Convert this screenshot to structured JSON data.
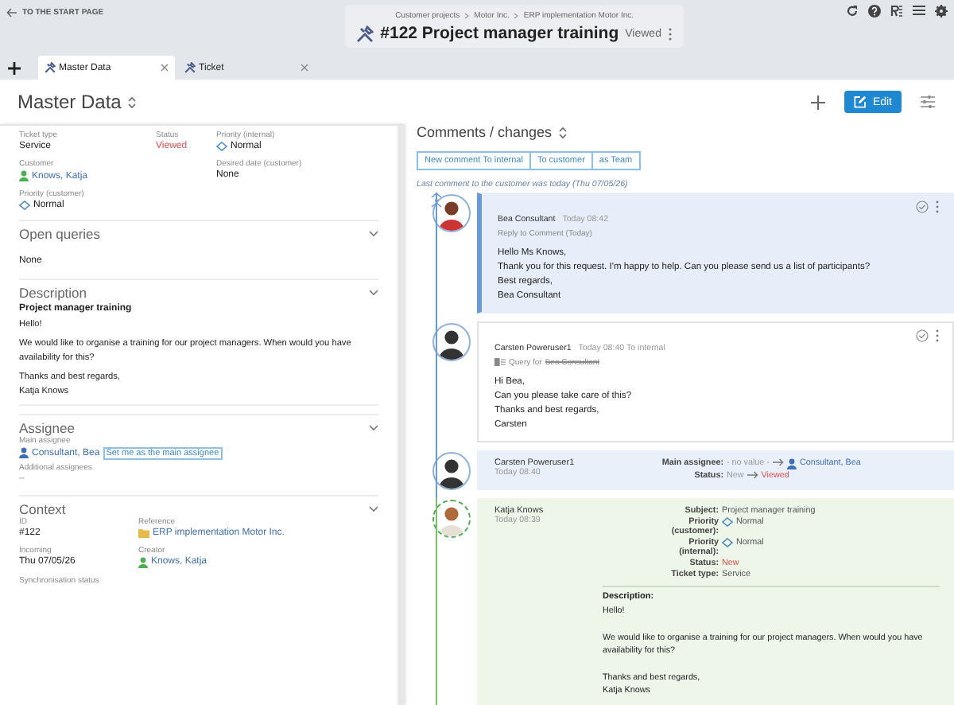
{
  "start_link": "TO THE START PAGE",
  "breadcrumbs": [
    "Customer projects",
    "Motor Inc.",
    "ERP implementation Motor Inc."
  ],
  "title": "#122 Project manager training",
  "title_status": "Viewed",
  "tabs": [
    {
      "label": "Master Data",
      "selected": true
    },
    {
      "label": "Ticket",
      "selected": false
    }
  ],
  "master_data": {
    "title": "Master Data",
    "field_rows": [
      [
        {
          "label": "Ticket type",
          "value": "Service",
          "kind": "text"
        },
        {
          "label": "Status",
          "value": "Viewed",
          "kind": "status"
        },
        {
          "label": "Priority (internal)",
          "value": "Normal",
          "kind": "priority"
        }
      ],
      [
        {
          "label": "Customer",
          "value": "Knows, Katja",
          "kind": "person",
          "color": "#4caf50"
        },
        {
          "label": "Desired date (customer)",
          "value": "None",
          "kind": "text"
        }
      ],
      [
        {
          "label": "Priority (customer)",
          "value": "Normal",
          "kind": "priority"
        }
      ]
    ]
  },
  "sections": [
    {
      "kind": "simple",
      "title": "Open queries",
      "value": "None"
    },
    {
      "kind": "description",
      "title": "Description",
      "subject": "Project manager training",
      "paragraphs": [
        "Hello!",
        "We would like to organise a training for our project managers. When would you have availability for this?",
        "Thanks and best regards,\nKatja Knows"
      ]
    },
    {
      "kind": "assignee",
      "title": "Assignee",
      "main_label": "Main assignee",
      "main_value": "Consultant, Bea",
      "color": "#3f6fb5",
      "set_me": "Set me as the main assignee",
      "additional_label": "Additional assignees",
      "additional_value": "–"
    },
    {
      "kind": "fields",
      "title": "Context",
      "field_rows": [
        [
          {
            "label": "ID",
            "value": "#122",
            "kind": "text"
          },
          {
            "label": "Reference",
            "value": "ERP implementation Motor Inc.",
            "kind": "reference"
          }
        ],
        [
          {
            "label": "Incoming",
            "value": "Thu 07/05/26",
            "kind": "text"
          },
          {
            "label": "Creator",
            "value": "Knows, Katja",
            "kind": "person",
            "color": "#4caf50"
          }
        ],
        [
          {
            "label": "Synchronisation status"
          }
        ]
      ]
    }
  ],
  "edit_button": "Edit",
  "comments": {
    "title": "Comments / changes",
    "buttons": [
      "New comment To internal",
      "To customer",
      "as Team"
    ],
    "note": "Last comment to the customer was today (Thu 07/05/26)",
    "entries": [
      {
        "kind": "reply",
        "author": "Bea Consultant",
        "time": "Today 08:42",
        "subline": "Reply to Comment (Today)",
        "text": "Hello Ms Knows,\nThank you for this request. I'm happy to help. Can you please send us a list of participants?\nBest regards,\nBea Consultant"
      },
      {
        "kind": "internal",
        "author": "Carsten Poweruser1",
        "time": "Today 08:40 To internal",
        "subline": "Query for",
        "subline_person": "Bea Consultant",
        "text": "Hi Bea,\nCan you please take care of this?\nThanks and best regards,\nCarsten"
      },
      {
        "kind": "change",
        "author": "Carsten Poweruser1",
        "time": "Today 08:40",
        "changes": [
          {
            "label": "Main assignee:",
            "old": "- no value -",
            "new": "Consultant, Bea",
            "kind": "person",
            "color": "#3f6fb5"
          },
          {
            "label": "Status:",
            "old": "New",
            "new": "Viewed",
            "kind": "status"
          }
        ]
      },
      {
        "kind": "creation",
        "author": "Katja Knows",
        "time": "Today 08:39",
        "changes": [
          {
            "label": "Subject:",
            "value": "Project manager training",
            "kind": "text"
          },
          {
            "label": "Priority (customer):",
            "value": "Normal",
            "kind": "priority"
          },
          {
            "label": "Priority (internal):",
            "value": "Normal",
            "kind": "priority"
          },
          {
            "label": "Status:",
            "value": "New",
            "kind": "status"
          },
          {
            "label": "Ticket type:",
            "value": "Service",
            "kind": "text"
          }
        ],
        "description_label": "Description:",
        "description": "Hello!\n\nWe would like to organise a training for our project managers. When would you have availability for this?\n\nThanks and best regards,\nKatja Knows"
      }
    ]
  }
}
